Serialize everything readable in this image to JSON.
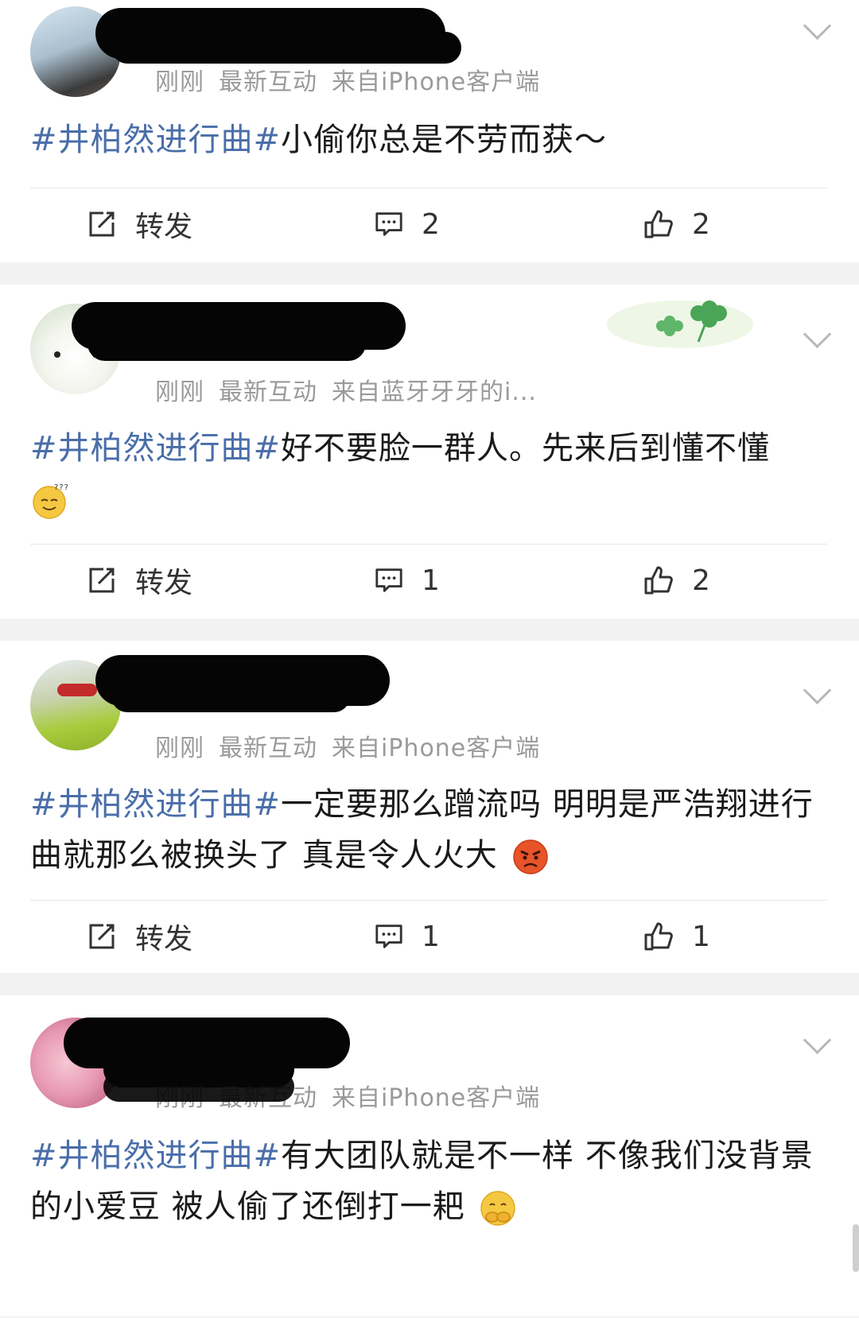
{
  "posts": [
    {
      "meta": {
        "time": "刚刚",
        "sort": "最新互动",
        "source": "来自iPhone客户端"
      },
      "hashtag": "#井柏然进行曲#",
      "text": "小偷你总是不劳而获～",
      "emoji": "",
      "repost_label": "转发",
      "comments": "2",
      "likes": "2"
    },
    {
      "meta": {
        "time": "刚刚",
        "sort": "最新互动",
        "source": "来自蓝牙牙牙的i..."
      },
      "hashtag": "#井柏然进行曲#",
      "text": "好不要脸一群人。先来后到懂不懂",
      "emoji": "confused-face-emoji",
      "repost_label": "转发",
      "comments": "1",
      "likes": "2"
    },
    {
      "meta": {
        "time": "刚刚",
        "sort": "最新互动",
        "source": "来自iPhone客户端"
      },
      "hashtag": "#井柏然进行曲#",
      "text": "一定要那么蹭流吗 明明是严浩翔进行曲就那么被换头了 真是令人火大",
      "emoji": "angry-face-emoji",
      "repost_label": "转发",
      "comments": "1",
      "likes": "1"
    },
    {
      "meta": {
        "time": "刚刚",
        "sort": "最新互动",
        "source": "来自iPhone客户端"
      },
      "hashtag": "#井柏然进行曲#",
      "text": "有大团队就是不一样 不像我们没背景的小爱豆 被人偷了还倒打一耙",
      "emoji": "covering-mouth-emoji"
    }
  ],
  "colors": {
    "hashtag": "#4a6ea9",
    "meta": "#9a9a9a",
    "background": "#f2f2f2"
  }
}
